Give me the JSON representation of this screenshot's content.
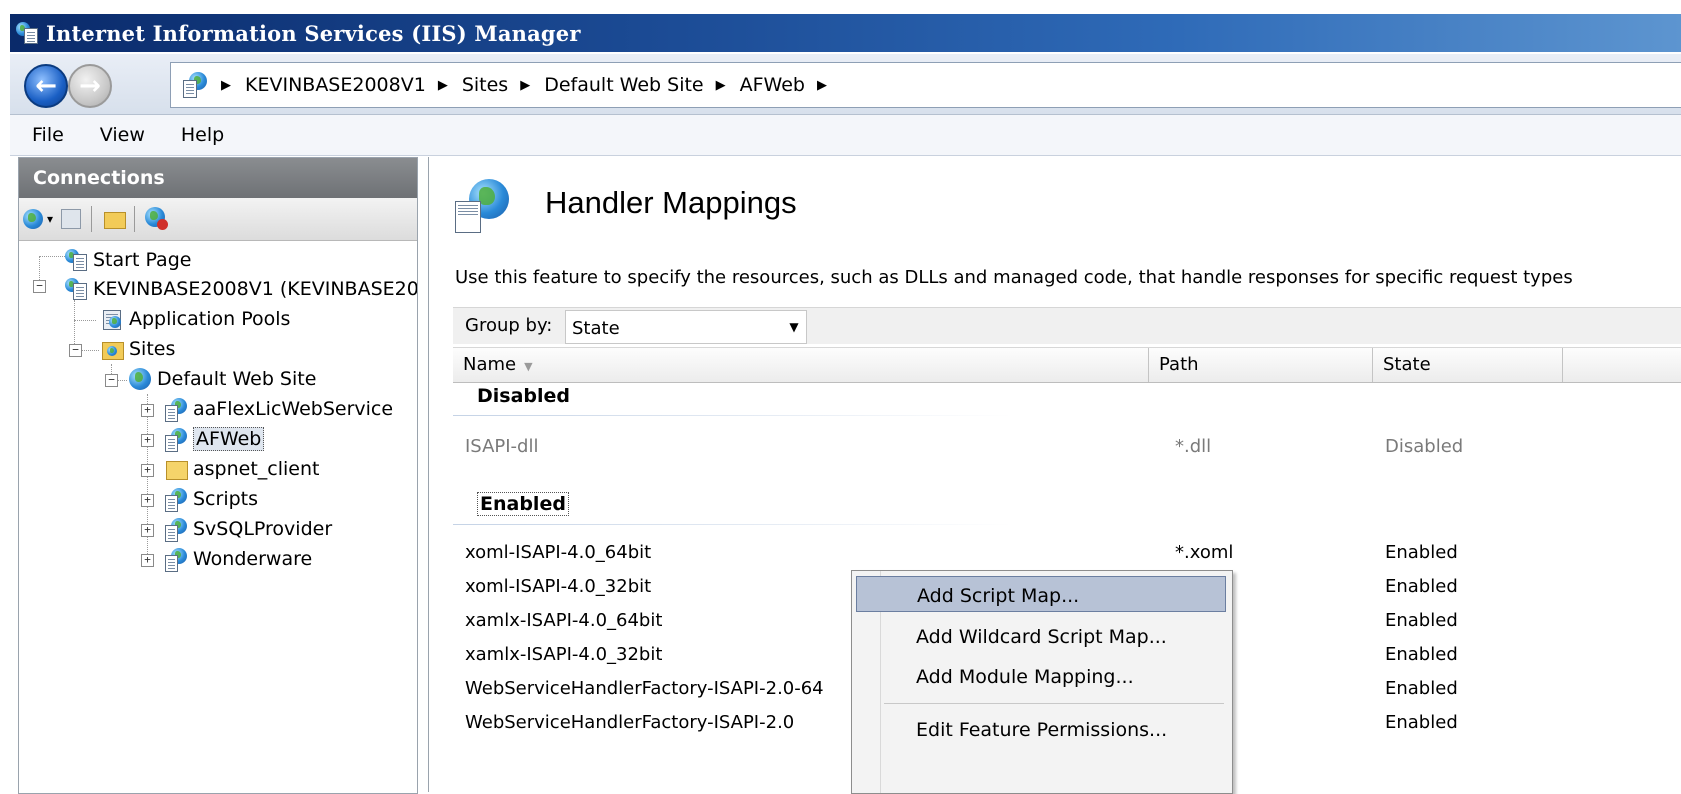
{
  "window": {
    "title": "Internet Information Services (IIS) Manager"
  },
  "breadcrumb": [
    "KEVINBASE2008V1",
    "Sites",
    "Default Web Site",
    "AFWeb"
  ],
  "menu": [
    "File",
    "View",
    "Help"
  ],
  "connections": {
    "title": "Connections",
    "tree": {
      "start_page": "Start Page",
      "server": "KEVINBASE2008V1 (KEVINBASE200",
      "app_pools": "Application Pools",
      "sites": "Sites",
      "default_site": "Default Web Site",
      "children": [
        "aaFlexLicWebService",
        "AFWeb",
        "aspnet_client",
        "Scripts",
        "SvSQLProvider",
        "Wonderware"
      ]
    }
  },
  "feature": {
    "title": "Handler Mappings",
    "description": "Use this feature to specify the resources, such as DLLs and managed code, that handle responses for specific request types"
  },
  "groupby": {
    "label": "Group by:",
    "value": "State"
  },
  "columns": {
    "name": "Name",
    "path": "Path",
    "state": "State"
  },
  "groups": {
    "disabled": "Disabled",
    "enabled": "Enabled"
  },
  "disabled_rows": [
    {
      "name": "ISAPI-dll",
      "path": "*.dll",
      "state": "Disabled"
    }
  ],
  "enabled_rows": [
    {
      "name": "xoml-ISAPI-4.0_64bit",
      "path": "*.xoml",
      "state": "Enabled"
    },
    {
      "name": "xoml-ISAPI-4.0_32bit",
      "path": "",
      "state": "Enabled"
    },
    {
      "name": "xamlx-ISAPI-4.0_64bit",
      "path": "",
      "state": "Enabled"
    },
    {
      "name": "xamlx-ISAPI-4.0_32bit",
      "path": "",
      "state": "Enabled"
    },
    {
      "name": "WebServiceHandlerFactory-ISAPI-2.0-64",
      "path": "",
      "state": "Enabled"
    },
    {
      "name": "WebServiceHandlerFactory-ISAPI-2.0",
      "path": "",
      "state": "Enabled"
    }
  ],
  "context_menu": [
    "Add Script Map...",
    "Add Wildcard Script Map...",
    "Add Module Mapping...",
    "Edit Feature Permissions..."
  ],
  "colors": {
    "title_bar": "#1c4c96",
    "menu_highlight": "#b7c2d6",
    "pane_header": "#6e7175"
  }
}
